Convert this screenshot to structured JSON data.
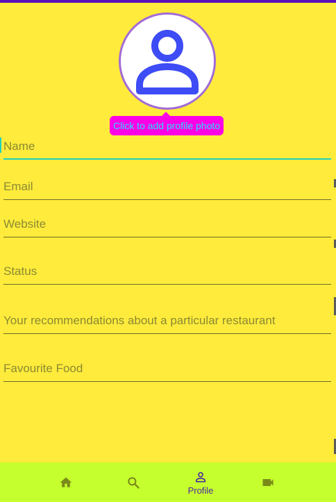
{
  "profile": {
    "avatar_icon": "person-outline-icon",
    "add_photo_tooltip": "Click to add profile photo"
  },
  "form": {
    "fields": [
      {
        "name": "name-field",
        "label": "Name",
        "focused": true
      },
      {
        "name": "email-field",
        "label": "Email"
      },
      {
        "name": "website-field",
        "label": "Website"
      },
      {
        "name": "status-field",
        "label": "Status"
      },
      {
        "name": "recommendations-field",
        "label": "Your recommendations about a particular restaurant"
      },
      {
        "name": "favourite-food-field",
        "label": "Favourite Food"
      }
    ]
  },
  "bottom_nav": {
    "items": [
      {
        "name": "nav-home",
        "icon": "home-icon"
      },
      {
        "name": "nav-search",
        "icon": "search-icon"
      },
      {
        "name": "nav-profile",
        "icon": "person-icon",
        "label": "Profile",
        "selected": true
      },
      {
        "name": "nav-video",
        "icon": "videocam-icon"
      }
    ]
  },
  "colors": {
    "background": "#ffeb3b",
    "accent_icon": "#3d4cf5",
    "avatar_border": "#a36bd6",
    "tooltip_bg": "#ff00e6",
    "tooltip_text": "#22e0ff",
    "focus_line": "#1fd1c1",
    "nav_bg": "#c6ff2e",
    "nav_selected": "#4a2a9e"
  }
}
